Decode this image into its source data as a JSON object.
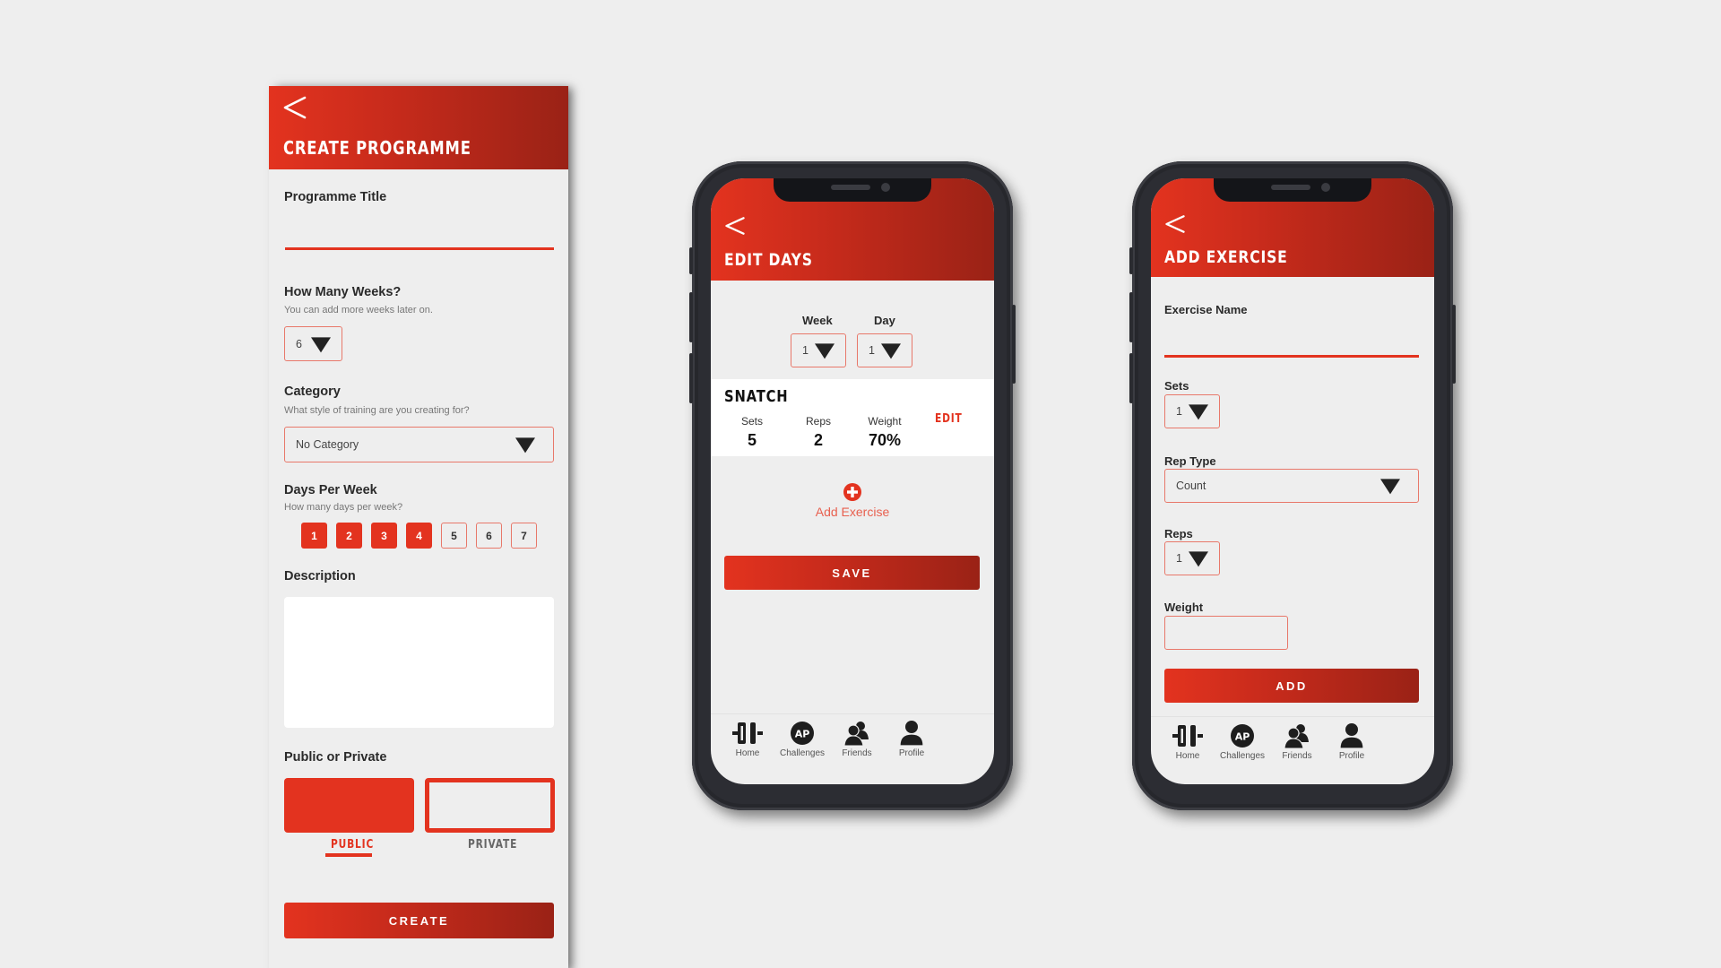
{
  "colors": {
    "accent": "#e3331f",
    "accent_dark": "#9a2216",
    "background": "#eeeeee",
    "phone_frame": "#2c2d33"
  },
  "create_programme": {
    "header": {
      "back_icon": "chevron-left-icon",
      "title": "CREATE PROGRAMME"
    },
    "programme_title": {
      "label": "Programme Title",
      "value": ""
    },
    "weeks": {
      "label": "How Many Weeks?",
      "hint": "You can add more weeks later on.",
      "value": "6"
    },
    "category": {
      "label": "Category",
      "hint": "What style of training are you creating for?",
      "value": "No Category"
    },
    "days_per_week": {
      "label": "Days Per Week",
      "hint": "How many days per week?",
      "options": [
        {
          "label": "1",
          "selected": true
        },
        {
          "label": "2",
          "selected": true
        },
        {
          "label": "3",
          "selected": true
        },
        {
          "label": "4",
          "selected": true
        },
        {
          "label": "5",
          "selected": false
        },
        {
          "label": "6",
          "selected": false
        },
        {
          "label": "7",
          "selected": false
        }
      ]
    },
    "description": {
      "label": "Description",
      "value": ""
    },
    "visibility": {
      "label": "Public or Private",
      "public_label": "PUBLIC",
      "private_label": "PRIVATE",
      "selected": "PUBLIC"
    },
    "create_button": "CREATE"
  },
  "edit_days": {
    "header": {
      "back_icon": "chevron-left-icon",
      "title": "EDIT DAYS"
    },
    "week": {
      "label": "Week",
      "value": "1"
    },
    "day": {
      "label": "Day",
      "value": "1"
    },
    "exercise": {
      "name": "SNATCH",
      "edit_label": "EDIT",
      "sets_label": "Sets",
      "sets_value": "5",
      "reps_label": "Reps",
      "reps_value": "2",
      "weight_label": "Weight",
      "weight_value": "70%"
    },
    "add_exercise": {
      "icon": "plus-circle-icon",
      "label": "Add Exercise"
    },
    "save_button": "SAVE"
  },
  "add_exercise": {
    "header": {
      "back_icon": "chevron-left-icon",
      "title": "ADD EXERCISE"
    },
    "exercise_name": {
      "label": "Exercise Name",
      "value": ""
    },
    "sets": {
      "label": "Sets",
      "value": "1"
    },
    "rep_type": {
      "label": "Rep Type",
      "value": "Count"
    },
    "reps": {
      "label": "Reps",
      "value": "1"
    },
    "weight": {
      "label": "Weight",
      "value": ""
    },
    "add_button": "ADD"
  },
  "tabbar": [
    {
      "label": "Home",
      "icon": "barbell-icon"
    },
    {
      "label": "Challenges",
      "icon": "ap-badge-icon",
      "badge": "AP"
    },
    {
      "label": "Friends",
      "icon": "friends-icon"
    },
    {
      "label": "Profile",
      "icon": "profile-icon"
    }
  ]
}
